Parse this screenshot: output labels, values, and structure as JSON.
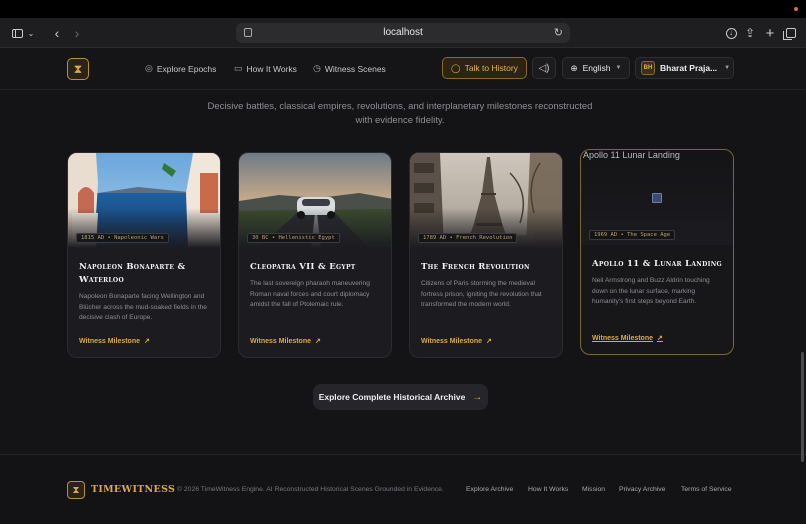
{
  "browser": {
    "url": "localhost"
  },
  "nav": {
    "links": [
      {
        "label": "Explore Epochs",
        "icon": "compass-icon"
      },
      {
        "label": "How It Works",
        "icon": "book-icon"
      },
      {
        "label": "Witness Scenes",
        "icon": "clock-icon"
      }
    ],
    "talk_label": "Talk to History",
    "language": "English",
    "user_initials": "BH",
    "user_name": "Bharat Praja..."
  },
  "subtitle": "Decisive battles, classical empires, revolutions, and interplanetary milestones reconstructed with evidence fidelity.",
  "cards": [
    {
      "tag": "1815 AD • Napoleonic Wars",
      "title": "Napoleon Bonaparte & Waterloo",
      "description": "Napoleon Bonaparte facing Wellington and Blücher across the mud-soaked fields in the decisive clash of Europe.",
      "link": "Witness Milestone"
    },
    {
      "tag": "30 BC • Hellenistic Egypt",
      "title": "Cleopatra VII & Egypt",
      "description": "The last sovereign pharaoh maneuvering Roman naval forces and court diplomacy amidst the fall of Ptolemaic rule.",
      "link": "Witness Milestone"
    },
    {
      "tag": "1789 AD • French Revolution",
      "title": "The French Revolution",
      "description": "Citizens of Paris storming the medieval fortress prison, igniting the revolution that transformed the modern world.",
      "link": "Witness Milestone"
    },
    {
      "alt_text": "Apollo 11 Lunar Landing",
      "tag": "1969 AD • The Space Age",
      "title": "Apollo 11 & Lunar Landing",
      "description": "Neil Armstrong and Buzz Aldrin touching down on the lunar surface, marking humanity's first steps beyond Earth.",
      "link": "Witness Milestone"
    }
  ],
  "archive_button": "Explore Complete Historical Archive",
  "footer": {
    "brand": "TIMEWITNESS",
    "copyright": "© 2026 TimeWitness Engine. AI Reconstructed Historical Scenes Grounded in Evidence.",
    "links": [
      "Explore Archive",
      "How It Works",
      "Mission",
      "Privacy Archive",
      "Terms of Service"
    ]
  },
  "colors": {
    "accent": "#d9a94a",
    "background": "#141416",
    "card": "#1c1c20"
  }
}
